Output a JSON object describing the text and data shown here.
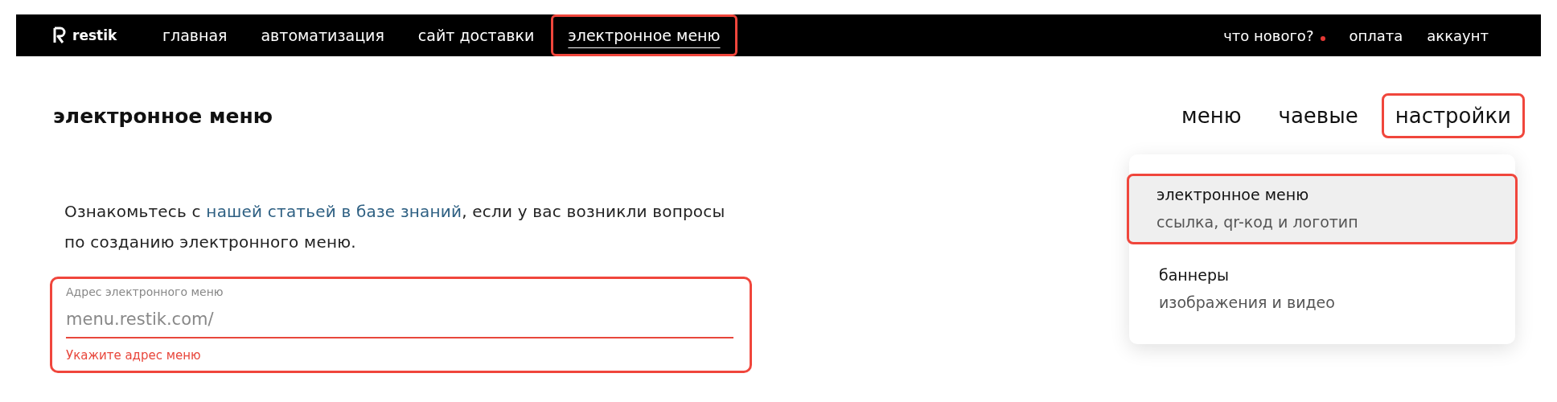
{
  "top_nav": {
    "logo": "restik",
    "items": [
      {
        "label": "главная",
        "selected": false,
        "highlighted": false
      },
      {
        "label": "автоматизация",
        "selected": false,
        "highlighted": false
      },
      {
        "label": "сайт доставки",
        "selected": false,
        "highlighted": false
      },
      {
        "label": "электронное меню",
        "selected": true,
        "highlighted": true
      }
    ],
    "right_items": [
      {
        "label": "что нового?",
        "badge": true
      },
      {
        "label": "оплата",
        "badge": false
      },
      {
        "label": "аккаунт",
        "badge": false
      }
    ]
  },
  "page": {
    "title": "электронное меню",
    "tabs": [
      {
        "label": "меню",
        "highlighted": false
      },
      {
        "label": "чаевые",
        "highlighted": false
      },
      {
        "label": "настройки",
        "highlighted": true
      }
    ]
  },
  "intro": {
    "text": "Ознакомьтесь с ",
    "link": "нашей статьей в базе знаний",
    "rest": ", если у вас возникли вопросы по созданию электронного меню."
  },
  "field": {
    "label": "Адрес электронного меню",
    "value": "menu.restik.com/",
    "error": "Укажите адрес меню",
    "highlighted": true
  },
  "dropdown": {
    "items": [
      {
        "title": "электронное меню",
        "subtitle": "ссылка, qr-код и логотип",
        "selected": true,
        "highlighted": true
      },
      {
        "title": "баннеры",
        "subtitle": "изображения и видео",
        "selected": false,
        "highlighted": false
      }
    ]
  }
}
